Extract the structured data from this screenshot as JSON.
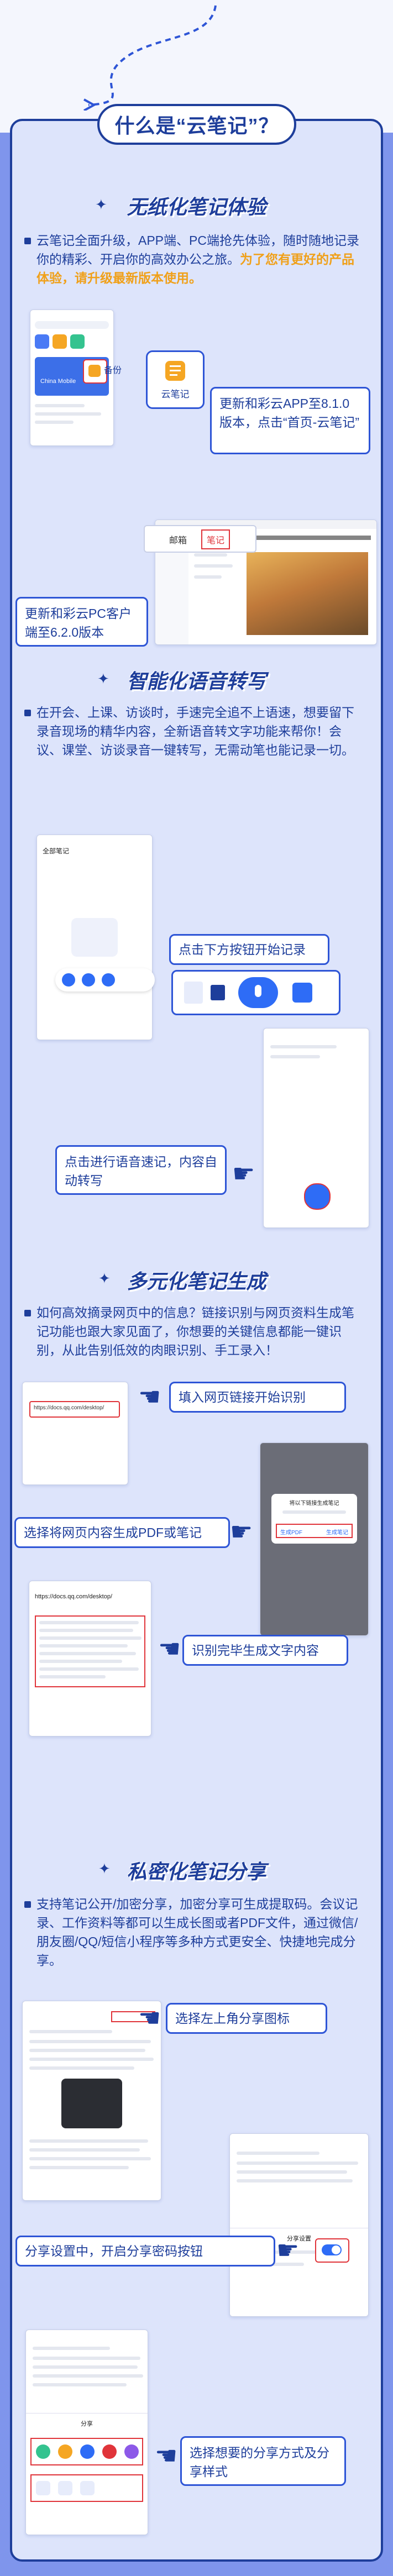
{
  "page": {
    "title": "什么是“云笔记”？"
  },
  "section1": {
    "title": "无纸化笔记体验",
    "text_normal": "云笔记全面升级，APP端、PC端抢先体验，随时随地记录你的精彩、开启你的高效办公之旅。",
    "text_highlight": "为了您有更好的产品体验，请升级最新版本使用。",
    "app_tile_label": "云笔记",
    "app_side_label": "备份",
    "callout_app": "更新和彩云APP至8.1.0版本，点击“首页-云笔记”",
    "pc_tab_mail": "邮箱",
    "pc_tab_notes": "笔记",
    "callout_pc": "更新和彩云PC客户端至6.2.0版本",
    "app_brand": "China Mobile"
  },
  "section2": {
    "title": "智能化语音转写",
    "text": "在开会、上课、访谈时，手速完全追不上语速，想要留下录音现场的精华内容，全新语音转文字功能来帮你！会议、课堂、访谈录音一键转写，无需动笔也能记录一切。",
    "phone_title": "全部笔记",
    "callout_record": "点击下方按钮开始记录",
    "callout_transcribe": "点击进行语音速记，内容自动转写"
  },
  "section3": {
    "title": "多元化笔记生成",
    "text": "如何高效摘录网页中的信息？链接识别与网页资料生成笔记功能也跟大家见面了，你想要的关键信息都能一键识别，从此告别低效的肉眼识别、手工录入！",
    "url_sample": "https://docs.qq.com/desktop/",
    "callout_url": "填入网页链接开始识别",
    "callout_pdf": "选择将网页内容生成PDF或笔记",
    "dialog_title": "将以下链接生成笔记",
    "dialog_btn_pdf": "生成PDF",
    "dialog_btn_note": "生成笔记",
    "callout_done": "识别完毕生成文字内容"
  },
  "section4": {
    "title": "私密化笔记分享",
    "text": "支持笔记公开/加密分享，加密分享可生成提取码。会议记录、工作资料等都可以生成长图或者PDF文件，通过微信/朋友圈/QQ/短信小程序等多种方式更安全、快捷地完成分享。",
    "callout_share_icon": "选择左上角分享图标",
    "callout_password": "分享设置中，开启分享密码按钮",
    "share_settings_title": "分享设置",
    "callout_style": "选择想要的分享方式及分享样式",
    "share_sheet_title": "分享"
  },
  "colors": {
    "primary": "#1e3e9b",
    "accent_blue": "#2e55d6",
    "highlight": "#f0a019",
    "background": "#7f95ec",
    "card": "#dde4fb"
  }
}
